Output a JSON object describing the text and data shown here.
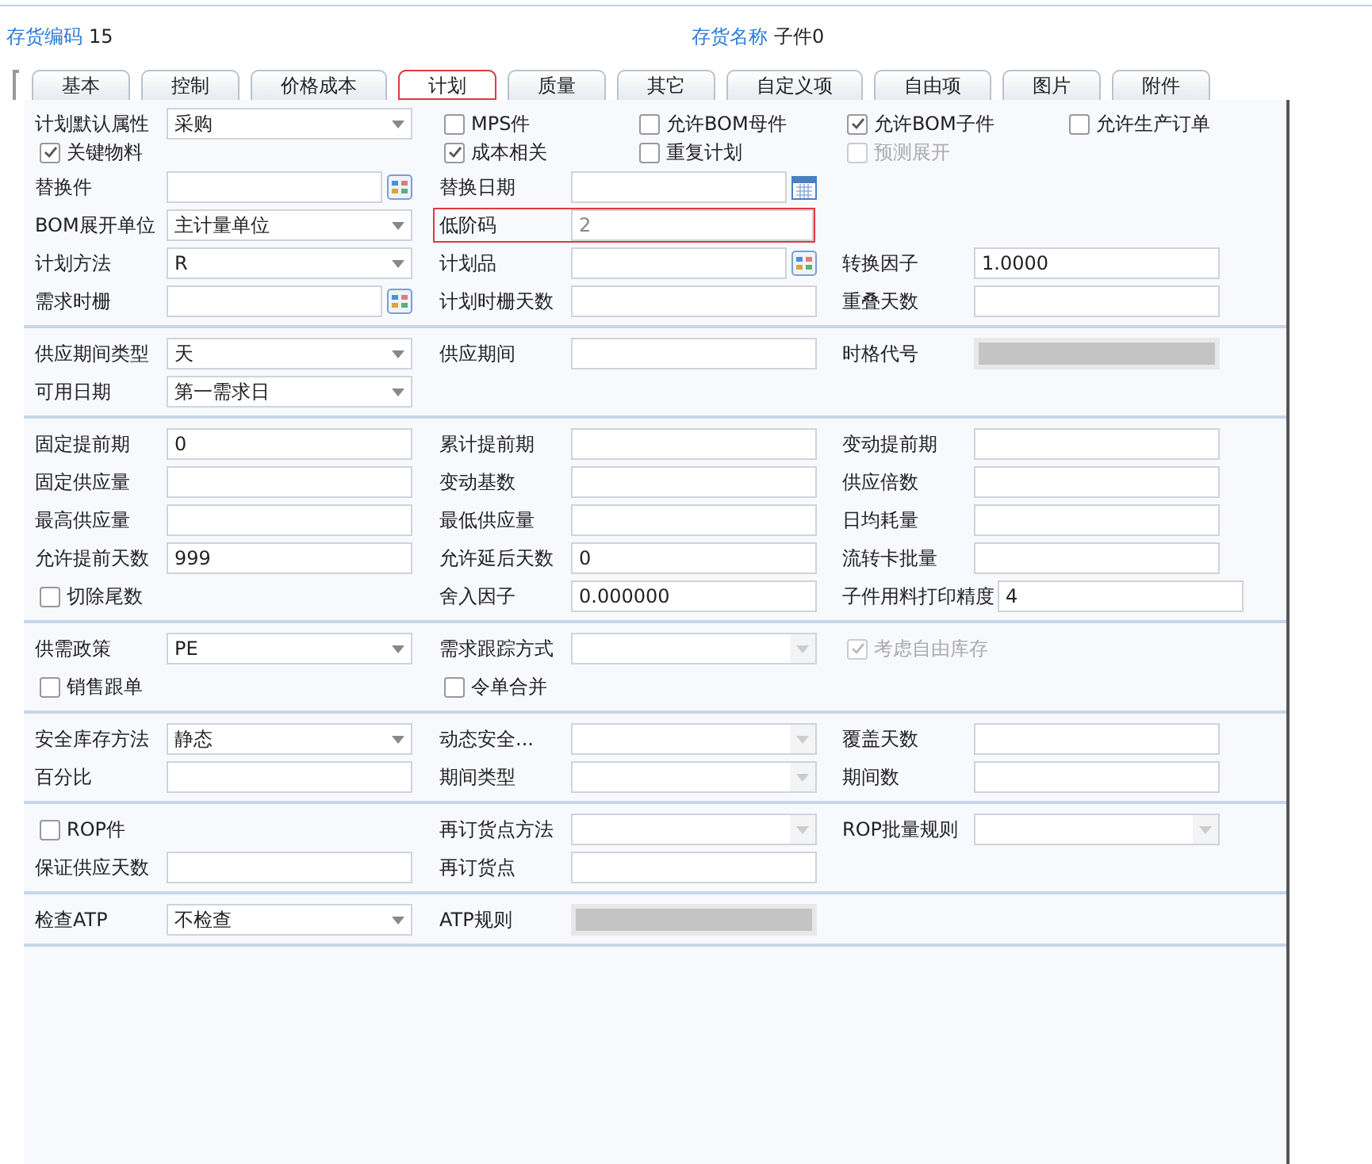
{
  "header": {
    "code_label": "存货编码",
    "code": "15",
    "name_label": "存货名称",
    "name": "子件0"
  },
  "tabs": [
    {
      "label": "基本",
      "selected": false,
      "highlighted": false
    },
    {
      "label": "控制",
      "selected": false,
      "highlighted": false
    },
    {
      "label": "价格成本",
      "selected": false,
      "highlighted": false
    },
    {
      "label": "计划",
      "selected": true,
      "highlighted": true
    },
    {
      "label": "质量",
      "selected": false,
      "highlighted": false
    },
    {
      "label": "其它",
      "selected": false,
      "highlighted": false
    },
    {
      "label": "自定义项",
      "selected": false,
      "highlighted": false
    },
    {
      "label": "自由项",
      "selected": false,
      "highlighted": false
    },
    {
      "label": "图片",
      "selected": false,
      "highlighted": false
    },
    {
      "label": "附件",
      "selected": false,
      "highlighted": false
    }
  ],
  "sections": [
    {
      "rows": [
        {
          "kind": "checks",
          "cells": [
            {
              "kind": "select",
              "label": "计划默认属性",
              "value": "采购"
            },
            {
              "kind": "check",
              "label": "MPS件",
              "checked": false,
              "disabled": false
            },
            {
              "kind": "check",
              "label": "允许BOM母件",
              "checked": false,
              "disabled": false
            },
            {
              "kind": "check",
              "label": "允许BOM子件",
              "checked": true,
              "disabled": false
            },
            {
              "kind": "check",
              "label": "允许生产订单",
              "checked": false,
              "disabled": false
            }
          ]
        },
        {
          "kind": "checks",
          "cells": [
            {
              "kind": "check",
              "label": "关键物料",
              "checked": true,
              "disabled": false
            },
            {
              "kind": "check",
              "label": "成本相关",
              "checked": true,
              "disabled": false
            },
            {
              "kind": "check",
              "label": "重复计划",
              "checked": false,
              "disabled": false
            },
            {
              "kind": "check",
              "label": "预测展开",
              "checked": false,
              "disabled": true
            }
          ]
        },
        {
          "kind": "fields",
          "cells": [
            {
              "kind": "lookup",
              "label": "替换件"
            },
            {
              "kind": "date",
              "label": "替换日期"
            }
          ]
        },
        {
          "kind": "fields",
          "cells": [
            {
              "kind": "select",
              "label": "BOM展开单位",
              "value": "主计量单位"
            },
            {
              "kind": "text",
              "label": "低阶码",
              "value": "2",
              "readonly": true,
              "highlighted": true
            }
          ]
        },
        {
          "kind": "fields",
          "cells": [
            {
              "kind": "select",
              "label": "计划方法",
              "value": "R"
            },
            {
              "kind": "lookup",
              "label": "计划品"
            },
            {
              "kind": "text",
              "label": "转换因子",
              "value": "1.0000"
            }
          ]
        },
        {
          "kind": "fields",
          "cells": [
            {
              "kind": "lookup",
              "label": "需求时栅"
            },
            {
              "kind": "text",
              "label": "计划时栅天数"
            },
            {
              "kind": "text",
              "label": "重叠天数"
            }
          ]
        }
      ]
    },
    {
      "rows": [
        {
          "kind": "fields",
          "cells": [
            {
              "kind": "select",
              "label": "供应期间类型",
              "value": "天"
            },
            {
              "kind": "text",
              "label": "供应期间"
            },
            {
              "kind": "text",
              "label": "时格代号",
              "disabled": true
            }
          ]
        },
        {
          "kind": "fields",
          "cells": [
            {
              "kind": "select",
              "label": "可用日期",
              "value": "第一需求日"
            }
          ]
        }
      ]
    },
    {
      "rows": [
        {
          "kind": "fields",
          "cells": [
            {
              "kind": "text",
              "label": "固定提前期",
              "value": "0"
            },
            {
              "kind": "text",
              "label": "累计提前期"
            },
            {
              "kind": "text",
              "label": "变动提前期"
            }
          ]
        },
        {
          "kind": "fields",
          "cells": [
            {
              "kind": "text",
              "label": "固定供应量"
            },
            {
              "kind": "text",
              "label": "变动基数"
            },
            {
              "kind": "text",
              "label": "供应倍数"
            }
          ]
        },
        {
          "kind": "fields",
          "cells": [
            {
              "kind": "text",
              "label": "最高供应量"
            },
            {
              "kind": "text",
              "label": "最低供应量"
            },
            {
              "kind": "text",
              "label": "日均耗量"
            }
          ]
        },
        {
          "kind": "fields",
          "cells": [
            {
              "kind": "text",
              "label": "允许提前天数",
              "value": "999"
            },
            {
              "kind": "text",
              "label": "允许延后天数",
              "value": "0"
            },
            {
              "kind": "text",
              "label": "流转卡批量"
            }
          ]
        },
        {
          "kind": "fields",
          "cells": [
            {
              "kind": "check",
              "label": "切除尾数",
              "checked": false,
              "disabled": false
            },
            {
              "kind": "text",
              "label": "舍入因子",
              "value": "0.000000"
            },
            {
              "kind": "text",
              "label": "子件用料打印精度",
              "value": "4"
            }
          ]
        }
      ]
    },
    {
      "rows": [
        {
          "kind": "fields",
          "cells": [
            {
              "kind": "select",
              "label": "供需政策",
              "value": "PE"
            },
            {
              "kind": "select",
              "label": "需求跟踪方式",
              "disabled": true
            },
            {
              "kind": "check",
              "label": "考虑自由库存",
              "checked": true,
              "disabled": true
            }
          ]
        },
        {
          "kind": "fields",
          "cells": [
            {
              "kind": "check",
              "label": "销售跟单",
              "checked": false,
              "disabled": false
            },
            {
              "kind": "check",
              "label": "令单合并",
              "checked": false,
              "disabled": false
            }
          ]
        }
      ]
    },
    {
      "rows": [
        {
          "kind": "fields",
          "cells": [
            {
              "kind": "select",
              "label": "安全库存方法",
              "value": "静态"
            },
            {
              "kind": "select",
              "label": "动态安全...",
              "disabled": true
            },
            {
              "kind": "text",
              "label": "覆盖天数"
            }
          ]
        },
        {
          "kind": "fields",
          "cells": [
            {
              "kind": "text",
              "label": "百分比"
            },
            {
              "kind": "select",
              "label": "期间类型",
              "disabled": true
            },
            {
              "kind": "text",
              "label": "期间数"
            }
          ]
        }
      ]
    },
    {
      "rows": [
        {
          "kind": "fields",
          "cells": [
            {
              "kind": "check",
              "label": "ROP件",
              "checked": false,
              "disabled": false
            },
            {
              "kind": "select",
              "label": "再订货点方法",
              "disabled": true
            },
            {
              "kind": "select",
              "label": "ROP批量规则",
              "disabled": true
            }
          ]
        },
        {
          "kind": "fields",
          "cells": [
            {
              "kind": "text",
              "label": "保证供应天数"
            },
            {
              "kind": "text",
              "label": "再订货点"
            }
          ]
        }
      ]
    },
    {
      "rows": [
        {
          "kind": "fields",
          "cells": [
            {
              "kind": "select",
              "label": "检查ATP",
              "value": "不检查"
            },
            {
              "kind": "text",
              "label": "ATP规则",
              "disabled": true
            }
          ]
        }
      ]
    }
  ]
}
